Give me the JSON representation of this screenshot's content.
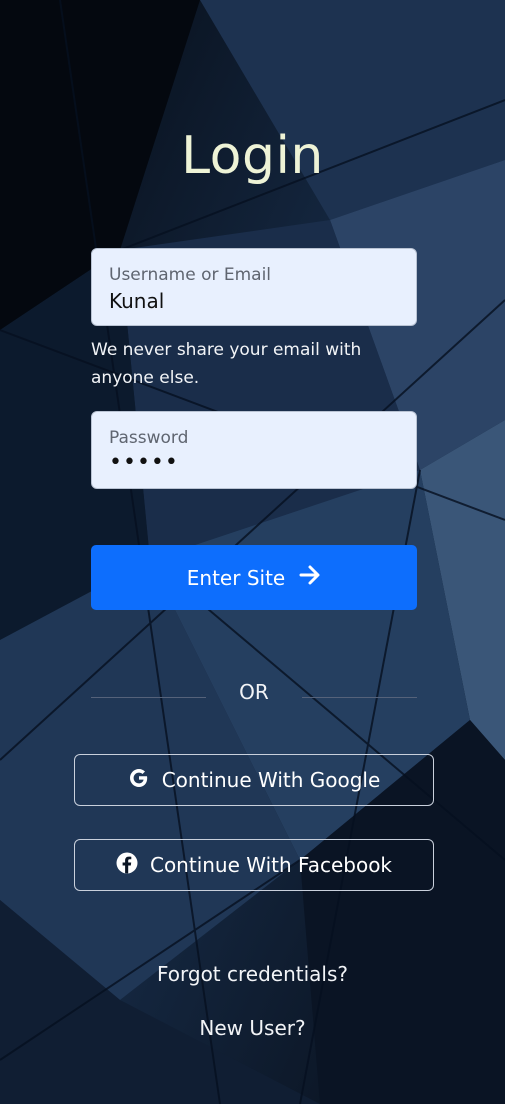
{
  "login": {
    "title": "Login",
    "username": {
      "label": "Username or Email",
      "value": "Kunal"
    },
    "help_text": "We never share your email with anyone else.",
    "password": {
      "label": "Password",
      "value": "•••••"
    },
    "submit_label": "Enter Site",
    "submit_icon": "arrow-right-icon",
    "divider_text": "OR",
    "google_label": "Continue With Google",
    "google_icon": "google-icon",
    "facebook_label": "Continue With Facebook",
    "facebook_icon": "facebook-icon",
    "forgot_label": "Forgot credentials?",
    "new_user_label": "New User?"
  },
  "colors": {
    "primary": "#0d6efd",
    "title": "#eef3d6",
    "field_bg": "#e8f0fe"
  }
}
